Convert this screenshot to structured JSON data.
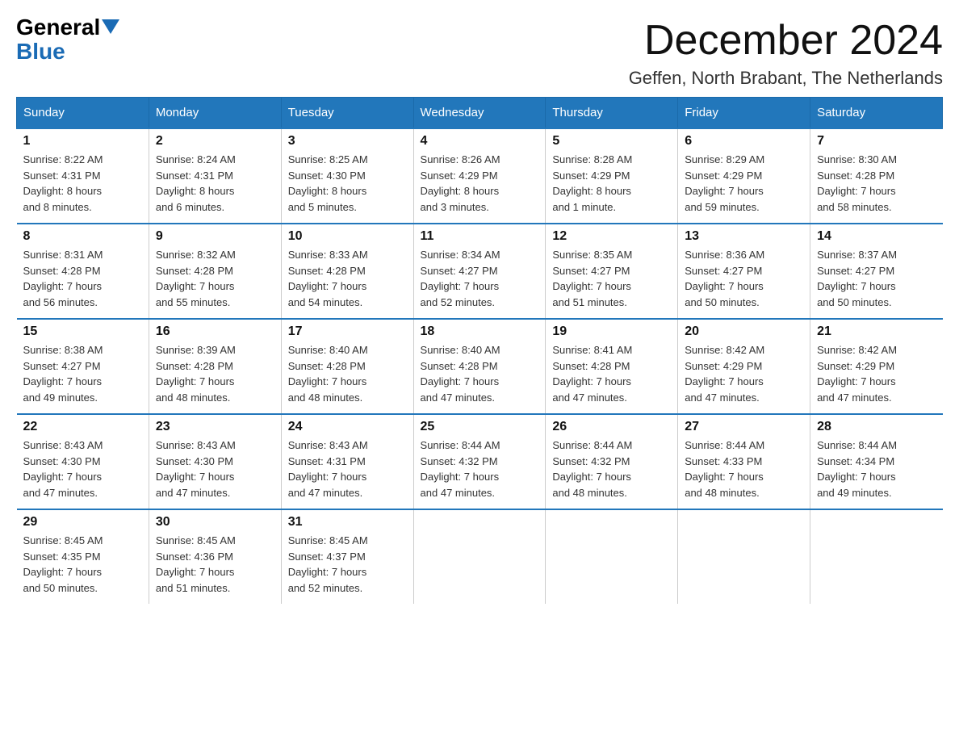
{
  "logo": {
    "general": "General",
    "blue": "Blue"
  },
  "header": {
    "title": "December 2024",
    "location": "Geffen, North Brabant, The Netherlands"
  },
  "weekdays": [
    "Sunday",
    "Monday",
    "Tuesday",
    "Wednesday",
    "Thursday",
    "Friday",
    "Saturday"
  ],
  "weeks": [
    [
      {
        "day": "1",
        "sunrise": "8:22 AM",
        "sunset": "4:31 PM",
        "daylight": "8 hours and 8 minutes."
      },
      {
        "day": "2",
        "sunrise": "8:24 AM",
        "sunset": "4:31 PM",
        "daylight": "8 hours and 6 minutes."
      },
      {
        "day": "3",
        "sunrise": "8:25 AM",
        "sunset": "4:30 PM",
        "daylight": "8 hours and 5 minutes."
      },
      {
        "day": "4",
        "sunrise": "8:26 AM",
        "sunset": "4:29 PM",
        "daylight": "8 hours and 3 minutes."
      },
      {
        "day": "5",
        "sunrise": "8:28 AM",
        "sunset": "4:29 PM",
        "daylight": "8 hours and 1 minute."
      },
      {
        "day": "6",
        "sunrise": "8:29 AM",
        "sunset": "4:29 PM",
        "daylight": "7 hours and 59 minutes."
      },
      {
        "day": "7",
        "sunrise": "8:30 AM",
        "sunset": "4:28 PM",
        "daylight": "7 hours and 58 minutes."
      }
    ],
    [
      {
        "day": "8",
        "sunrise": "8:31 AM",
        "sunset": "4:28 PM",
        "daylight": "7 hours and 56 minutes."
      },
      {
        "day": "9",
        "sunrise": "8:32 AM",
        "sunset": "4:28 PM",
        "daylight": "7 hours and 55 minutes."
      },
      {
        "day": "10",
        "sunrise": "8:33 AM",
        "sunset": "4:28 PM",
        "daylight": "7 hours and 54 minutes."
      },
      {
        "day": "11",
        "sunrise": "8:34 AM",
        "sunset": "4:27 PM",
        "daylight": "7 hours and 52 minutes."
      },
      {
        "day": "12",
        "sunrise": "8:35 AM",
        "sunset": "4:27 PM",
        "daylight": "7 hours and 51 minutes."
      },
      {
        "day": "13",
        "sunrise": "8:36 AM",
        "sunset": "4:27 PM",
        "daylight": "7 hours and 50 minutes."
      },
      {
        "day": "14",
        "sunrise": "8:37 AM",
        "sunset": "4:27 PM",
        "daylight": "7 hours and 50 minutes."
      }
    ],
    [
      {
        "day": "15",
        "sunrise": "8:38 AM",
        "sunset": "4:27 PM",
        "daylight": "7 hours and 49 minutes."
      },
      {
        "day": "16",
        "sunrise": "8:39 AM",
        "sunset": "4:28 PM",
        "daylight": "7 hours and 48 minutes."
      },
      {
        "day": "17",
        "sunrise": "8:40 AM",
        "sunset": "4:28 PM",
        "daylight": "7 hours and 48 minutes."
      },
      {
        "day": "18",
        "sunrise": "8:40 AM",
        "sunset": "4:28 PM",
        "daylight": "7 hours and 47 minutes."
      },
      {
        "day": "19",
        "sunrise": "8:41 AM",
        "sunset": "4:28 PM",
        "daylight": "7 hours and 47 minutes."
      },
      {
        "day": "20",
        "sunrise": "8:42 AM",
        "sunset": "4:29 PM",
        "daylight": "7 hours and 47 minutes."
      },
      {
        "day": "21",
        "sunrise": "8:42 AM",
        "sunset": "4:29 PM",
        "daylight": "7 hours and 47 minutes."
      }
    ],
    [
      {
        "day": "22",
        "sunrise": "8:43 AM",
        "sunset": "4:30 PM",
        "daylight": "7 hours and 47 minutes."
      },
      {
        "day": "23",
        "sunrise": "8:43 AM",
        "sunset": "4:30 PM",
        "daylight": "7 hours and 47 minutes."
      },
      {
        "day": "24",
        "sunrise": "8:43 AM",
        "sunset": "4:31 PM",
        "daylight": "7 hours and 47 minutes."
      },
      {
        "day": "25",
        "sunrise": "8:44 AM",
        "sunset": "4:32 PM",
        "daylight": "7 hours and 47 minutes."
      },
      {
        "day": "26",
        "sunrise": "8:44 AM",
        "sunset": "4:32 PM",
        "daylight": "7 hours and 48 minutes."
      },
      {
        "day": "27",
        "sunrise": "8:44 AM",
        "sunset": "4:33 PM",
        "daylight": "7 hours and 48 minutes."
      },
      {
        "day": "28",
        "sunrise": "8:44 AM",
        "sunset": "4:34 PM",
        "daylight": "7 hours and 49 minutes."
      }
    ],
    [
      {
        "day": "29",
        "sunrise": "8:45 AM",
        "sunset": "4:35 PM",
        "daylight": "7 hours and 50 minutes."
      },
      {
        "day": "30",
        "sunrise": "8:45 AM",
        "sunset": "4:36 PM",
        "daylight": "7 hours and 51 minutes."
      },
      {
        "day": "31",
        "sunrise": "8:45 AM",
        "sunset": "4:37 PM",
        "daylight": "7 hours and 52 minutes."
      },
      null,
      null,
      null,
      null
    ]
  ],
  "labels": {
    "sunrise": "Sunrise:",
    "sunset": "Sunset:",
    "daylight": "Daylight:"
  }
}
